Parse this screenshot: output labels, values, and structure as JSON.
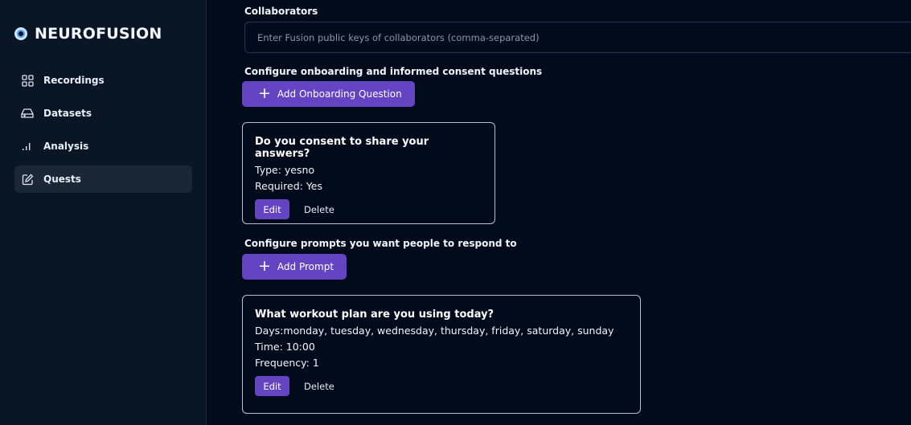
{
  "app": {
    "name": "NEUROFUSION"
  },
  "sidebar": {
    "items": [
      {
        "label": "Recordings",
        "icon": "grid-icon"
      },
      {
        "label": "Datasets",
        "icon": "database-drive-icon"
      },
      {
        "label": "Analysis",
        "icon": "bar-signal-icon"
      },
      {
        "label": "Quests",
        "icon": "edit-square-icon"
      }
    ],
    "active": "Quests"
  },
  "collaborators": {
    "label": "Collaborators",
    "placeholder": "Enter Fusion public keys of collaborators (comma-separated)"
  },
  "onboarding": {
    "label": "Configure onboarding and informed consent questions",
    "add_button": "Add Onboarding Question",
    "questions": [
      {
        "title": "Do you consent to share your answers?",
        "type_line": "Type: yesno",
        "required_line": "Required: Yes",
        "edit_label": "Edit",
        "delete_label": "Delete"
      }
    ]
  },
  "prompts": {
    "label": "Configure prompts you want people to respond to",
    "add_button": "Add Prompt",
    "items": [
      {
        "title": "What workout plan are you using today?",
        "days_line": "Days:monday, tuesday, wednesday, thursday, friday, saturday, sunday",
        "time_line": "Time: 10:00",
        "frequency_line": "Frequency: 1",
        "edit_label": "Edit",
        "delete_label": "Delete"
      }
    ]
  },
  "colors": {
    "background": "#020b1c",
    "sidebar": "#0a1525",
    "accent": "#6444c2",
    "card_border": "#b9c0cb"
  }
}
